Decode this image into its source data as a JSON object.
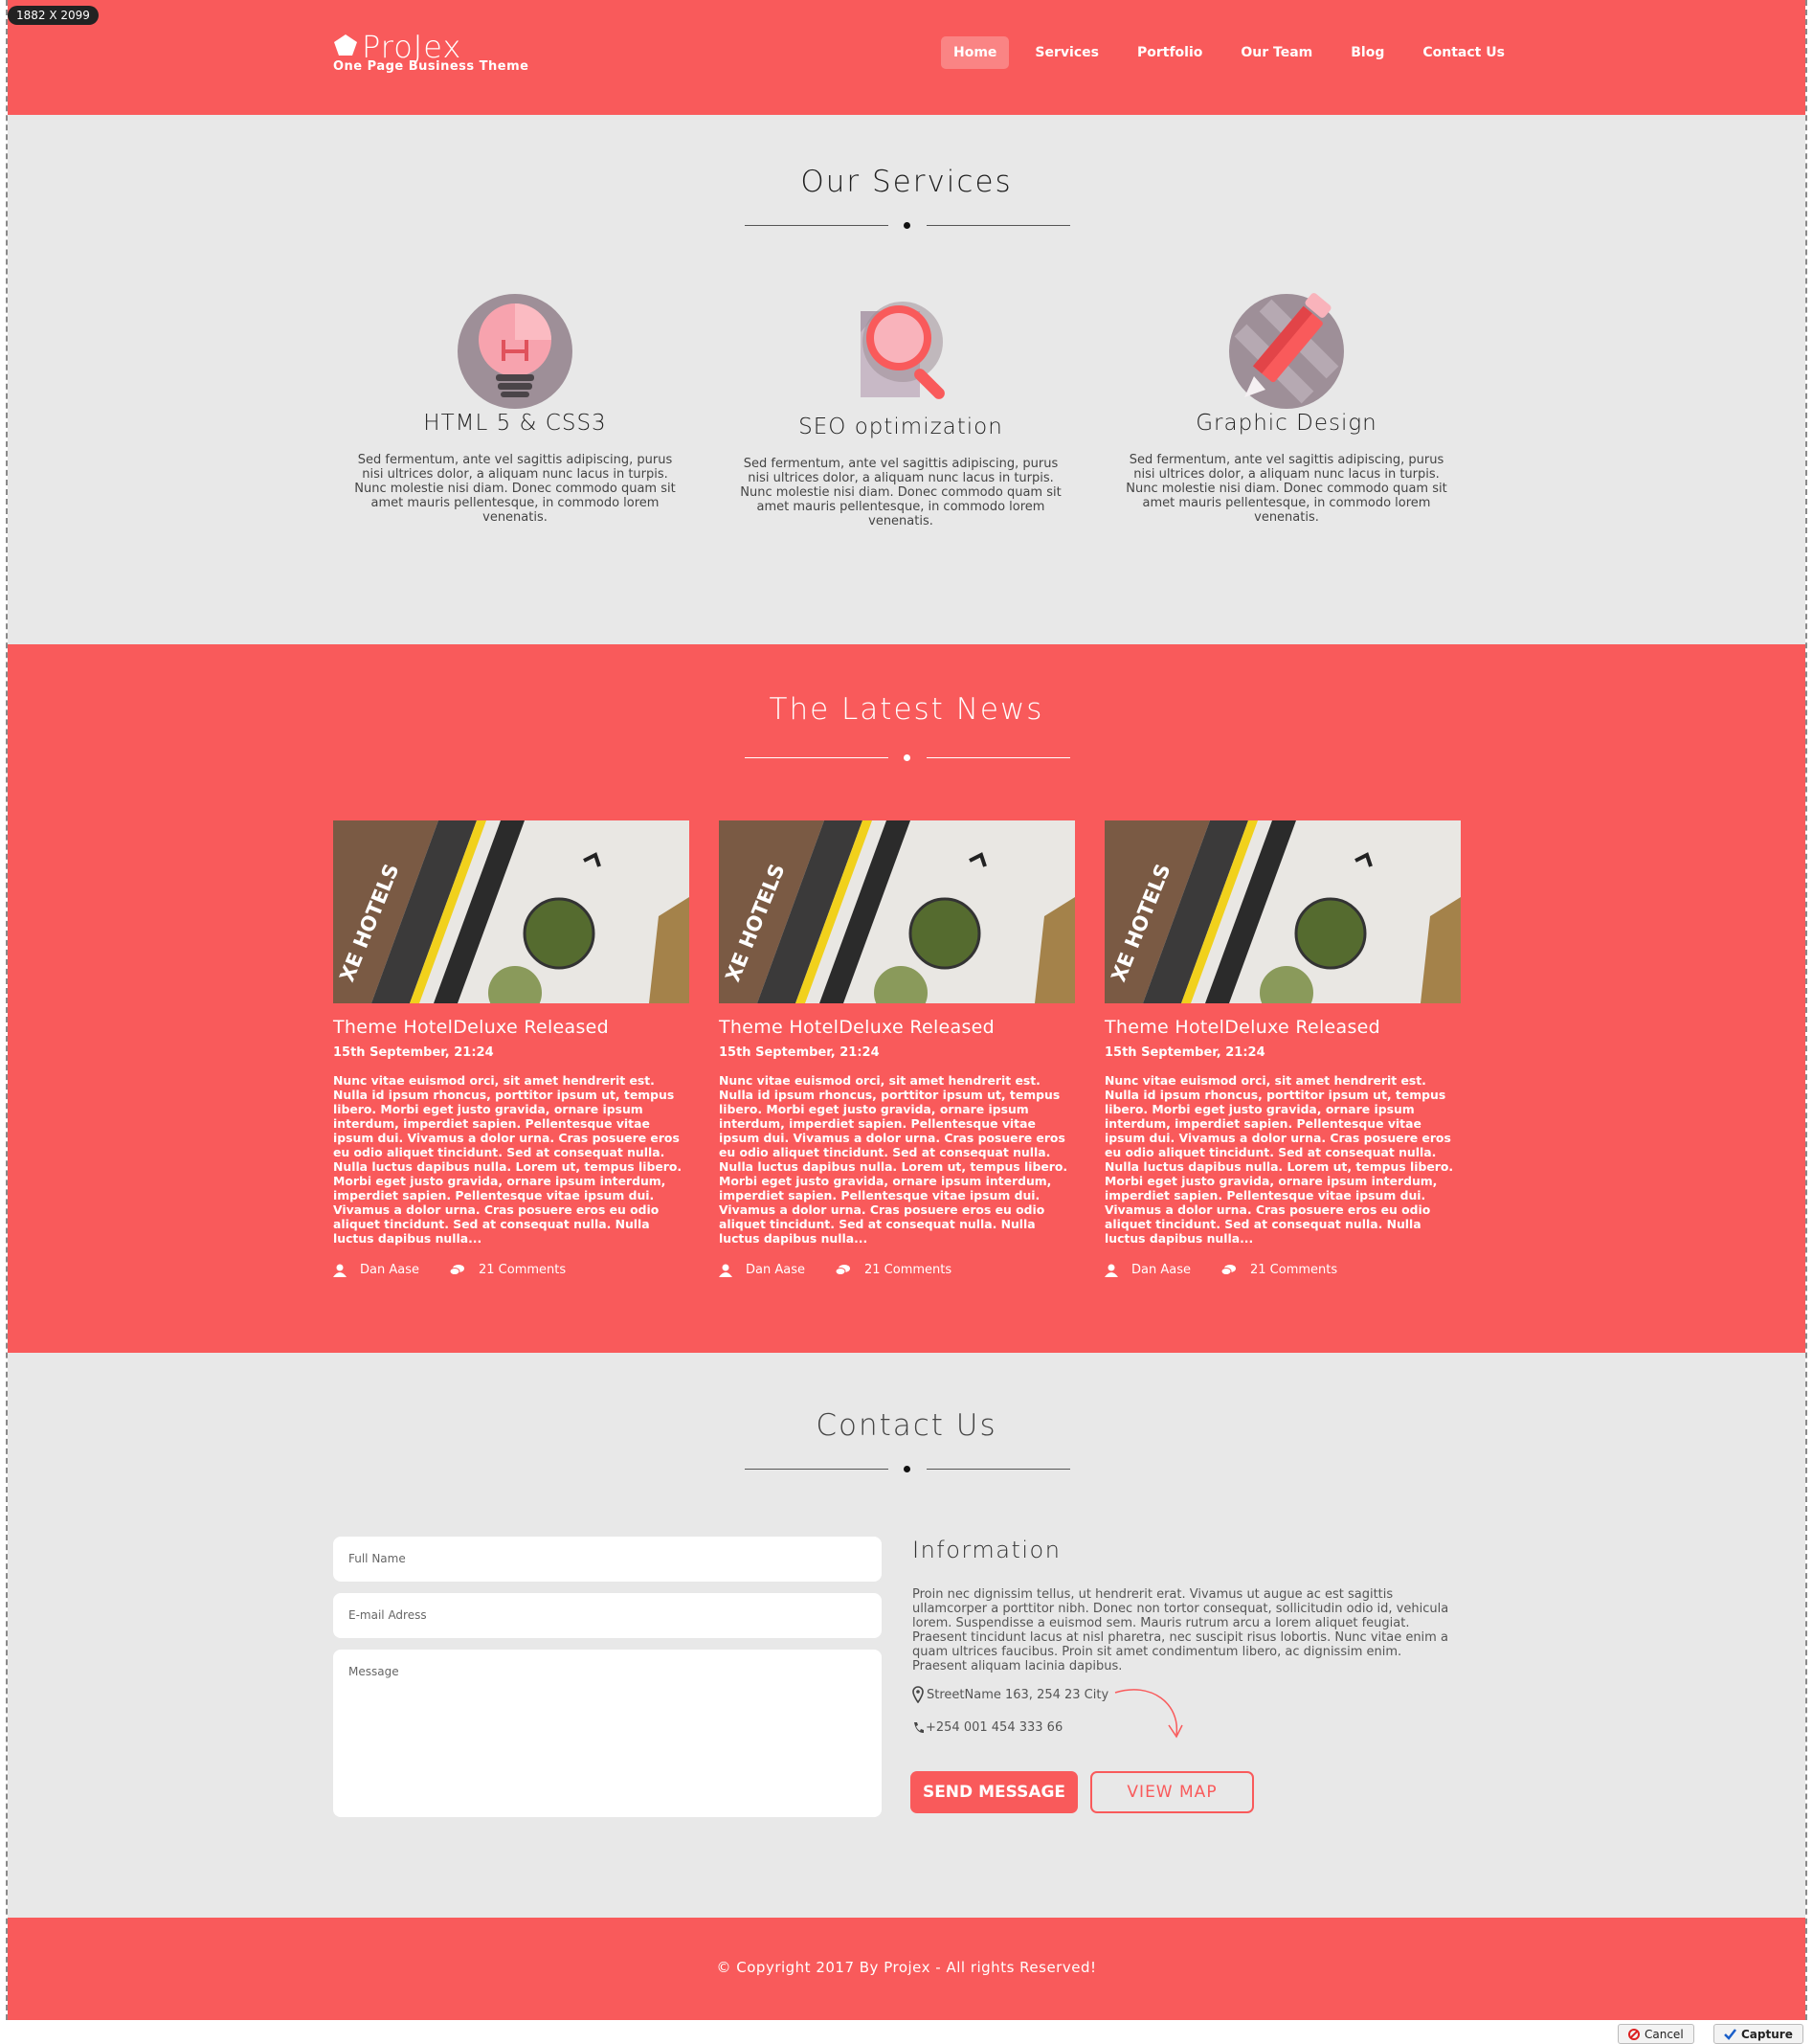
{
  "capture": {
    "dimension_badge": "1882 X 2099",
    "cancel_label": "Cancel",
    "capture_label": "Capture"
  },
  "colors": {
    "accent": "#f95a5b",
    "light_bg": "#e8e8e8",
    "nav_active_bg": "#fa8484"
  },
  "header": {
    "logo_name": "ProJex",
    "logo_tagline": "One Page Business Theme",
    "nav": [
      {
        "label": "Home",
        "active": true
      },
      {
        "label": "Services"
      },
      {
        "label": "Portfolio"
      },
      {
        "label": "Our Team"
      },
      {
        "label": "Blog"
      },
      {
        "label": "Contact Us"
      }
    ]
  },
  "services": {
    "title": "Our Services",
    "items": [
      {
        "title": "HTML 5 & CSS3",
        "icon": "lightbulb-icon",
        "text": "Sed fermentum, ante vel sagittis adipiscing, purus nisi ultrices dolor, a aliquam nunc lacus in turpis. Nunc molestie nisi diam. Donec commodo quam sit amet mauris pellentesque, in commodo lorem venenatis."
      },
      {
        "title": "SEO optimization",
        "icon": "magnifier-icon",
        "text": "Sed fermentum, ante vel sagittis adipiscing, purus nisi ultrices dolor, a aliquam nunc lacus in turpis. Nunc molestie nisi diam. Donec commodo quam sit amet mauris pellentesque, in commodo lorem venenatis."
      },
      {
        "title": "Graphic Design",
        "icon": "pencil-icon",
        "text": "Sed fermentum, ante vel sagittis adipiscing, purus nisi ultrices dolor, a aliquam nunc lacus in turpis. Nunc molestie nisi diam. Donec commodo quam sit amet mauris pellentesque, in commodo lorem venenatis."
      }
    ]
  },
  "news": {
    "title": "The Latest News",
    "posts": [
      {
        "title": "Theme HotelDeluxe Released",
        "date": "15th September, 21:24",
        "body": "Nunc vitae euismod orci, sit amet hendrerit est. Nulla id ipsum rhoncus, porttitor ipsum ut, tempus libero. Morbi eget justo gravida, ornare ipsum interdum, imperdiet sapien. Pellentesque vitae ipsum dui. Vivamus a dolor urna. Cras posuere eros eu odio aliquet tincidunt. Sed at consequat nulla. Nulla luctus dapibus nulla. Lorem ut, tempus libero. Morbi eget justo gravida, ornare ipsum interdum, imperdiet sapien. Pellentesque vitae ipsum dui. Vivamus a dolor urna. Cras posuere eros eu odio aliquet tincidunt. Sed at consequat nulla. Nulla luctus dapibus nulla...",
        "author": "Dan Aase",
        "comments": "21 Comments",
        "thumb_text": "XE HOTELS"
      },
      {
        "title": "Theme HotelDeluxe Released",
        "date": "15th September, 21:24",
        "body": "Nunc vitae euismod orci, sit amet hendrerit est. Nulla id ipsum rhoncus, porttitor ipsum ut, tempus libero. Morbi eget justo gravida, ornare ipsum interdum, imperdiet sapien. Pellentesque vitae ipsum dui. Vivamus a dolor urna. Cras posuere eros eu odio aliquet tincidunt. Sed at consequat nulla. Nulla luctus dapibus nulla. Lorem ut, tempus libero. Morbi eget justo gravida, ornare ipsum interdum, imperdiet sapien. Pellentesque vitae ipsum dui. Vivamus a dolor urna. Cras posuere eros eu odio aliquet tincidunt. Sed at consequat nulla. Nulla luctus dapibus nulla...",
        "author": "Dan Aase",
        "comments": "21 Comments",
        "thumb_text": "XE HOTELS"
      },
      {
        "title": "Theme HotelDeluxe Released",
        "date": "15th September, 21:24",
        "body": "Nunc vitae euismod orci, sit amet hendrerit est. Nulla id ipsum rhoncus, porttitor ipsum ut, tempus libero. Morbi eget justo gravida, ornare ipsum interdum, imperdiet sapien. Pellentesque vitae ipsum dui. Vivamus a dolor urna. Cras posuere eros eu odio aliquet tincidunt. Sed at consequat nulla. Nulla luctus dapibus nulla. Lorem ut, tempus libero. Morbi eget justo gravida, ornare ipsum interdum, imperdiet sapien. Pellentesque vitae ipsum dui. Vivamus a dolor urna. Cras posuere eros eu odio aliquet tincidunt. Sed at consequat nulla. Nulla luctus dapibus nulla...",
        "author": "Dan Aase",
        "comments": "21 Comments",
        "thumb_text": "XE HOTELS"
      }
    ]
  },
  "contact": {
    "title": "Contact Us",
    "form": {
      "name_placeholder": "Full Name",
      "email_placeholder": "E-mail Adress",
      "message_placeholder": "Message"
    },
    "info_title": "Information",
    "info_text": "Proin nec dignissim tellus, ut hendrerit erat. Vivamus ut augue ac est sagittis ullamcorper a porttitor nibh. Donec non tortor consequat, sollicitudin odio id, vehicula lorem. Suspendisse a euismod sem. Mauris rutrum arcu a lorem aliquet feugiat. Praesent tincidunt lacus at nisl pharetra, nec suscipit risus lobortis. Nunc vitae enim a quam ultrices faucibus. Proin sit amet condimentum libero, ac dignissim enim. Praesent aliquam lacinia dapibus.",
    "address": "StreetName 163, 254 23 City",
    "phone": "+254 001 454 333 66",
    "send_label": "SEND MESSAGE",
    "map_label": "VIEW MAP"
  },
  "footer": {
    "copyright": "© Copyright 2017 By Projex - All rights Reserved!"
  }
}
